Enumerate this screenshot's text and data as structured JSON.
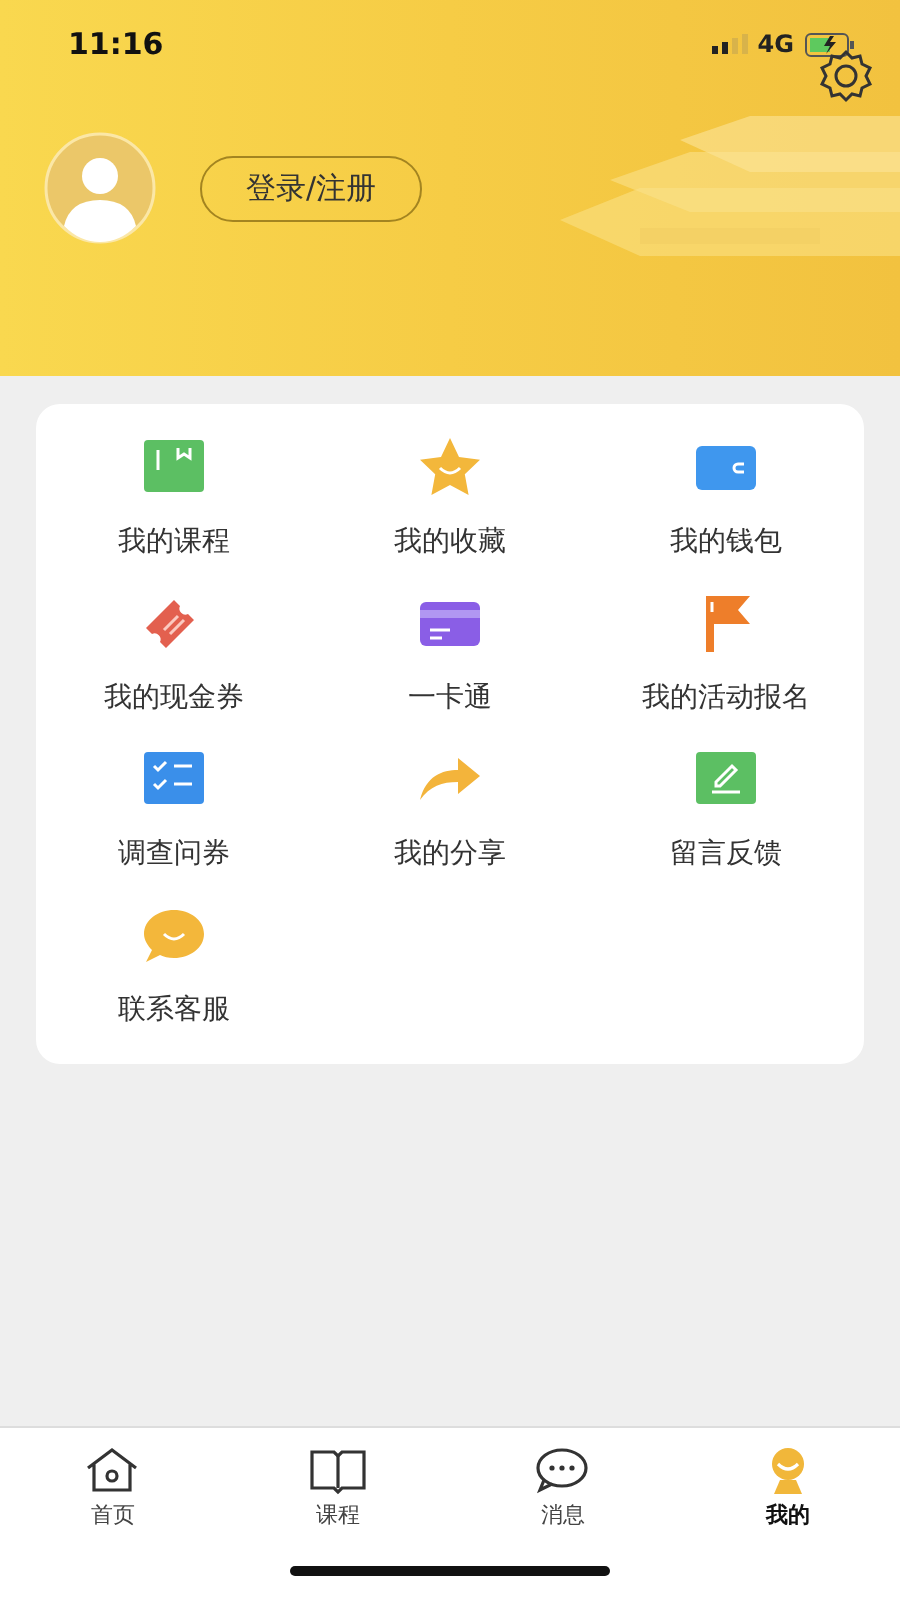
{
  "status_bar": {
    "time": "11:16",
    "network": "4G"
  },
  "profile": {
    "login_button": "登录/注册"
  },
  "menu": [
    {
      "kind": "course",
      "label": "我的课程"
    },
    {
      "kind": "star",
      "label": "我的收藏"
    },
    {
      "kind": "wallet",
      "label": "我的钱包"
    },
    {
      "kind": "coupon",
      "label": "我的现金券"
    },
    {
      "kind": "card",
      "label": "一卡通"
    },
    {
      "kind": "flag",
      "label": "我的活动报名"
    },
    {
      "kind": "survey",
      "label": "调查问券"
    },
    {
      "kind": "share",
      "label": "我的分享"
    },
    {
      "kind": "feedback",
      "label": "留言反馈"
    },
    {
      "kind": "chat",
      "label": "联系客服"
    }
  ],
  "tab_bar": [
    {
      "kind": "home",
      "label": "首页",
      "selected": false
    },
    {
      "kind": "book",
      "label": "课程",
      "selected": false
    },
    {
      "kind": "message",
      "label": "消息",
      "selected": false
    },
    {
      "kind": "me",
      "label": "我的",
      "selected": true
    }
  ]
}
